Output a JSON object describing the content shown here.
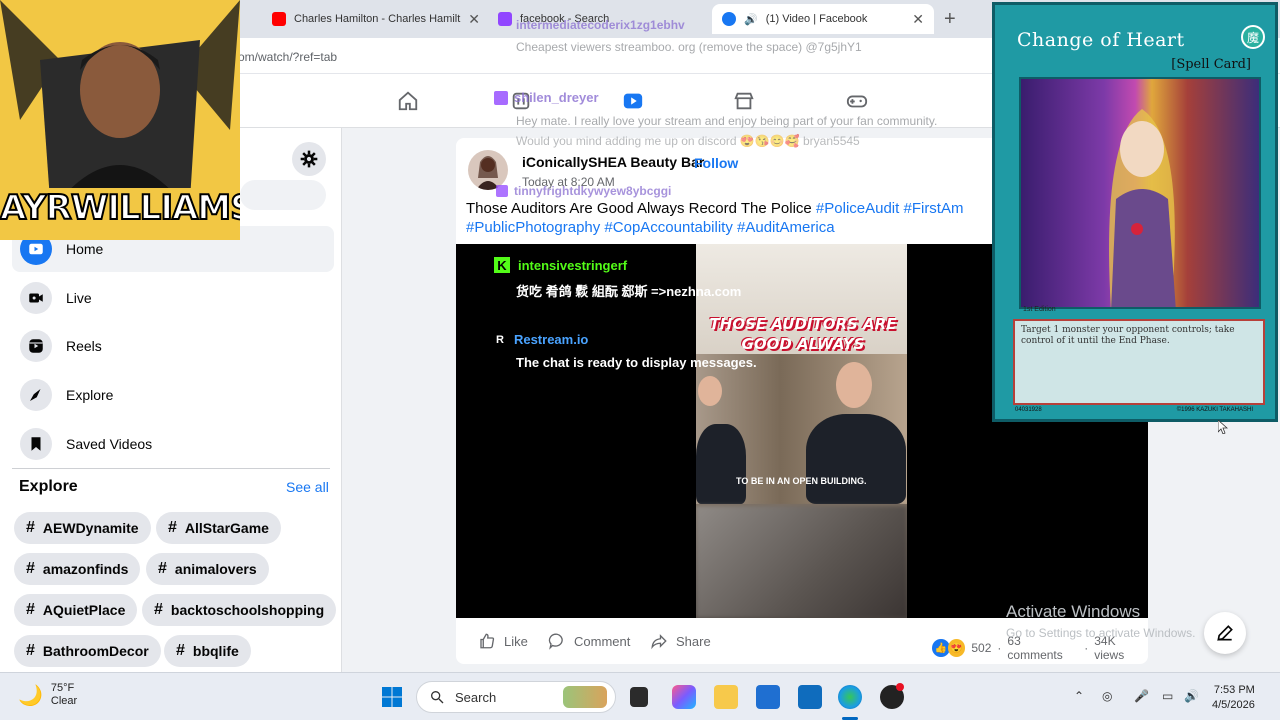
{
  "browser": {
    "tabs": [
      {
        "title": "Charles Hamilton - Charles Hamilt",
        "favicon_color": "#ff0000"
      },
      {
        "title": "facebook - Search",
        "favicon_color": "#9146ff"
      },
      {
        "title": "(1) Video | Facebook",
        "favicon_color": "#1877f2",
        "active": true
      }
    ],
    "address": "om/watch/?ref=tab",
    "overlay_user": "intermediatecoderix1zg1ebhv",
    "overlay_spam": "Cheapest viewers streamboo. org (remove the space) @7g5jhY1"
  },
  "stream_overlays": {
    "twitch_user1": "shilen_dreyer",
    "twitch_msg1": "Hey mate. I really love your stream and enjoy being part of your fan community.",
    "twitch_msg1b": "Would you mind adding me up on discord 😍😘😊🥰 bryan5545",
    "twitch_user2": "tinnyfrightdkywyew8ybcggi",
    "twitch_msg2": "Those Auditors Are Good Always Record The Police #PoliceAudit #FirstAm",
    "kick_user": "intensivestringerf",
    "kick_msg": "货吃 肴鸽 鬏 組酛 郄斯 =>nezhna.com",
    "restream_user": "Restream.io",
    "restream_msg": "The chat is ready to display messages.",
    "streamer_name": "AYRWILLIAMS"
  },
  "sidebar": {
    "items": [
      {
        "label": "Home",
        "icon": "watch-home-icon"
      },
      {
        "label": "Live",
        "icon": "live-icon"
      },
      {
        "label": "Reels",
        "icon": "reels-icon"
      },
      {
        "label": "Explore",
        "icon": "explore-icon"
      },
      {
        "label": "Saved Videos",
        "icon": "bookmark-icon"
      }
    ],
    "explore_title": "Explore",
    "see_all": "See all",
    "chips": [
      "AEWDynamite",
      "AllStarGame",
      "amazonfinds",
      "animalovers",
      "AQuietPlace",
      "backtoschoolshopping",
      "BathroomDecor",
      "bbqlife"
    ]
  },
  "post": {
    "author": "iConicallySHEA Beauty Bar",
    "follow": "Follow",
    "time": "Today at 8:20 AM",
    "caption_text": "Those Auditors Are Good Always Record The Police ",
    "hashtags_line1": "#PoliceAudit #FirstAm",
    "hashtags_line2": "#PublicPhotography #CopAccountability #AuditAmerica",
    "video_caption": "THOSE AUDITORS ARE GOOD ALWAYS RECORD THE POLICE",
    "video_subtitle": "TO BE IN AN OPEN BUILDING.",
    "actions": {
      "like": "Like",
      "comment": "Comment",
      "share": "Share"
    },
    "reaction_count": "502",
    "comments": "63 comments",
    "views": "34K views"
  },
  "card": {
    "title": "Change of Heart",
    "type": "[Spell Card]",
    "edition": "1st Edition",
    "effect": "Target 1 monster your opponent controls; take control of it until the End Phase.",
    "code": "04031928",
    "copyright": "©1996 KAZUKI TAKAHASHI",
    "attribute": "魔"
  },
  "windows": {
    "activate_title": "Activate Windows",
    "activate_sub": "Go to Settings to activate Windows.",
    "weather_temp": "75°F",
    "weather_desc": "Clear",
    "search_label": "Search",
    "time": "7:53 PM",
    "date": "4/5/2026"
  },
  "colors": {
    "fb_blue": "#1877f2",
    "twitch_purple": "#9146ff",
    "kick_green": "#53fc18",
    "card_teal": "#1f9aa4"
  }
}
